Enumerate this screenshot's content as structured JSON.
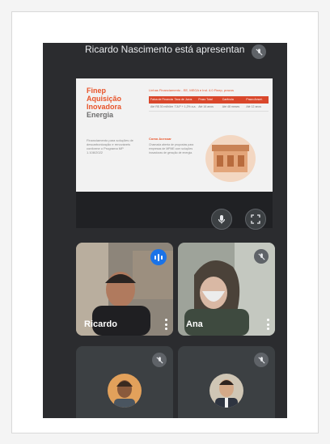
{
  "presenting_banner": "Ricardo Nascimento está apresentan",
  "slide": {
    "title_lines": [
      "Finep",
      "Aquisição",
      "Inovadora",
      "Energia"
    ],
    "description": "Financiamento para soluções de descarbonização e renováveis conforme o Programa MP 1.108/2022",
    "table_heading": "Linhas Financiamento - EE, MEGA e Ind. 4.0 Finep, prazos",
    "table_headers": [
      "Faixa de Financiamento",
      "Taxa de Juros",
      "Prazo Total",
      "Carência",
      "Prazo Amort."
    ],
    "table_rows": [
      [
        "Até R$ 30 milhões",
        "TJLP + 1,2% a.a.",
        "Até 16 anos",
        "Até 48 meses",
        "Até 12 anos"
      ]
    ],
    "sub_heading": "Como Acessar",
    "sub_text": "Chamada aberta de propostas para empresas de MPME com soluções inovadoras de geração de energia."
  },
  "controls": {
    "mic_icon": "microphone-icon",
    "fullscreen_icon": "fullscreen-icon"
  },
  "participants": [
    {
      "name": "Ricardo",
      "speaking": true
    },
    {
      "name": "Ana",
      "speaking": false
    },
    {
      "name": "",
      "speaking": false
    },
    {
      "name": "",
      "speaking": false
    }
  ],
  "colors": {
    "background": "#2b2c2f",
    "tile": "#3c4043",
    "accent": "#e8542a",
    "speaking": "#1a73e8"
  }
}
